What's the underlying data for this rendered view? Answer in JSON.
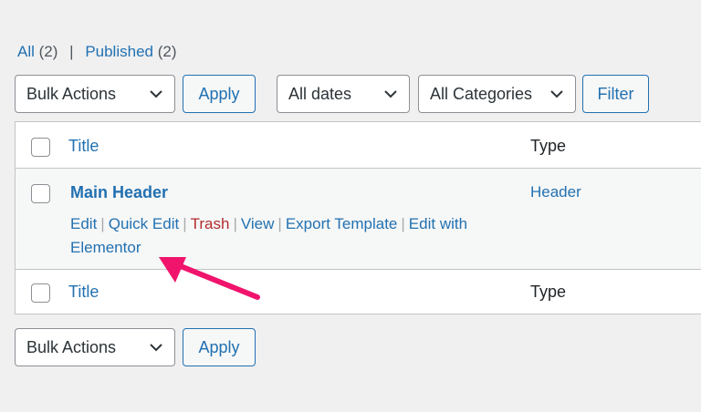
{
  "filters": {
    "all_label": "All",
    "all_count": "(2)",
    "separator": "|",
    "published_label": "Published",
    "published_count": "(2)"
  },
  "top_controls": {
    "bulk_actions": "Bulk Actions",
    "apply": "Apply",
    "dates": "All dates",
    "categories": "All Categories",
    "filter": "Filter"
  },
  "table": {
    "header": {
      "title": "Title",
      "type": "Type"
    },
    "rows": [
      {
        "title": "Main Header",
        "type": "Header",
        "actions": {
          "edit": "Edit",
          "quick_edit": "Quick Edit",
          "trash": "Trash",
          "view": "View",
          "export_template": "Export Template",
          "edit_with_elementor": "Edit with Elementor"
        }
      }
    ],
    "footer": {
      "title": "Title",
      "type": "Type"
    }
  },
  "bottom_controls": {
    "bulk_actions": "Bulk Actions",
    "apply": "Apply"
  },
  "colors": {
    "link": "#2271b1",
    "trash": "#b32d2e",
    "annotation_arrow": "#f0146c",
    "background": "#f0f0f1"
  },
  "icons": {
    "select_chevron": "chevron-down-icon",
    "annotation": "arrow-annotation-icon"
  }
}
